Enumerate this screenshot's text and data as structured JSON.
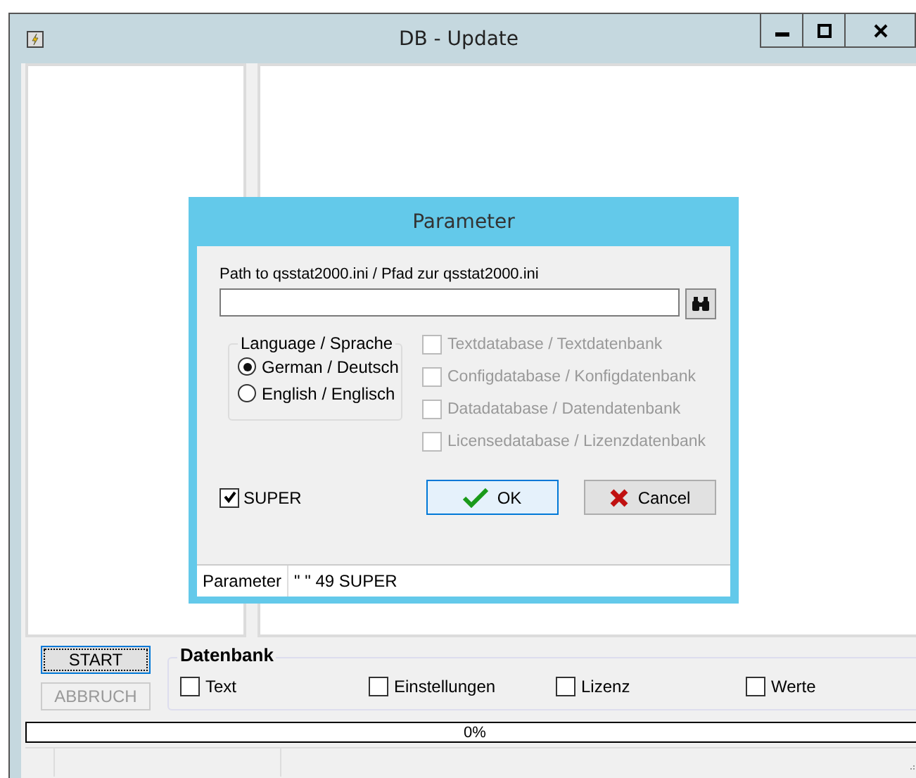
{
  "window": {
    "title": "DB - Update"
  },
  "dialog": {
    "title": "Parameter",
    "path_label": "Path to qsstat2000.ini / Pfad zur qsstat2000.ini",
    "language": {
      "title": "Language / Sprache",
      "options": [
        {
          "label": "German / Deutsch",
          "selected": true
        },
        {
          "label": "English / Englisch",
          "selected": false
        }
      ]
    },
    "databases": [
      {
        "label": "Textdatabase / Textdatenbank",
        "checked": false,
        "disabled": true
      },
      {
        "label": "Configdatabase / Konfigdatenbank",
        "checked": false,
        "disabled": true
      },
      {
        "label": "Datadatabase / Datendatenbank",
        "checked": false,
        "disabled": true
      },
      {
        "label": "Licensedatabase / Lizenzdatenbank",
        "checked": false,
        "disabled": true
      }
    ],
    "super": {
      "label": "SUPER",
      "checked": true
    },
    "buttons": [
      {
        "label": "OK",
        "kind": "ok"
      },
      {
        "label": "Cancel",
        "kind": "cancel"
      }
    ],
    "status_bar": [
      "Parameter",
      "\" \" 49   SUPER"
    ]
  },
  "actions": [
    {
      "label": "START",
      "disabled": false
    },
    {
      "label": "ABBRUCH",
      "disabled": true
    }
  ],
  "datenbank": {
    "title": "Datenbank",
    "options": [
      {
        "label": "Text",
        "checked": false
      },
      {
        "label": "Einstellungen",
        "checked": false
      },
      {
        "label": "Lizenz",
        "checked": false
      },
      {
        "label": "Werte",
        "checked": false
      }
    ]
  },
  "progress": {
    "level": 0,
    "text": "0%"
  }
}
